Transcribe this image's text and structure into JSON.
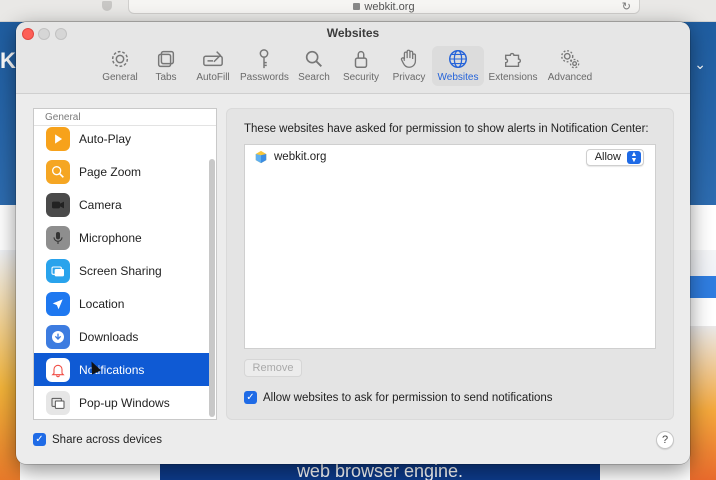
{
  "browser": {
    "url": "webkit.org",
    "page_partial_left": "Ki",
    "page_bottom_text": "web browser engine."
  },
  "window": {
    "title": "Websites"
  },
  "toolbar": {
    "items": [
      {
        "label": "General",
        "icon": "gear-icon"
      },
      {
        "label": "Tabs",
        "icon": "tabs-icon"
      },
      {
        "label": "AutoFill",
        "icon": "autofill-icon"
      },
      {
        "label": "Passwords",
        "icon": "key-icon"
      },
      {
        "label": "Search",
        "icon": "search-icon"
      },
      {
        "label": "Security",
        "icon": "lock-icon"
      },
      {
        "label": "Privacy",
        "icon": "hand-icon"
      },
      {
        "label": "Websites",
        "icon": "globe-icon",
        "active": true
      },
      {
        "label": "Extensions",
        "icon": "puzzle-icon"
      },
      {
        "label": "Advanced",
        "icon": "gears-icon"
      }
    ]
  },
  "sidebar": {
    "header": "General",
    "items": [
      {
        "label": "Auto-Play",
        "icon": "play-icon",
        "color": "#f7a21b"
      },
      {
        "label": "Page Zoom",
        "icon": "zoom-icon",
        "color": "#f5a623"
      },
      {
        "label": "Camera",
        "icon": "camera-icon",
        "color": "#4a4a4a"
      },
      {
        "label": "Microphone",
        "icon": "microphone-icon",
        "color": "#8e8e8e"
      },
      {
        "label": "Screen Sharing",
        "icon": "screen-sharing-icon",
        "color": "#29a3ec"
      },
      {
        "label": "Location",
        "icon": "location-icon",
        "color": "#1e78f0"
      },
      {
        "label": "Downloads",
        "icon": "download-icon",
        "color": "#3d7ce0"
      },
      {
        "label": "Notifications",
        "icon": "bell-icon",
        "color": "#f04c44",
        "selected": true
      },
      {
        "label": "Pop-up Windows",
        "icon": "popup-icon",
        "color": "#a6a6a6"
      }
    ]
  },
  "content": {
    "description": "These websites have asked for permission to show alerts in Notification Center:",
    "sites": [
      {
        "domain": "webkit.org",
        "permission": "Allow"
      }
    ],
    "remove_label": "Remove",
    "allow_checkbox_label": "Allow websites to ask for permission to send notifications",
    "allow_checked": true
  },
  "footer": {
    "share_label": "Share across devices",
    "share_checked": true,
    "help_label": "?"
  },
  "colors": {
    "accent": "#0f5ad4",
    "checkbox": "#1f6be6",
    "close_button": "#fd5f57"
  }
}
